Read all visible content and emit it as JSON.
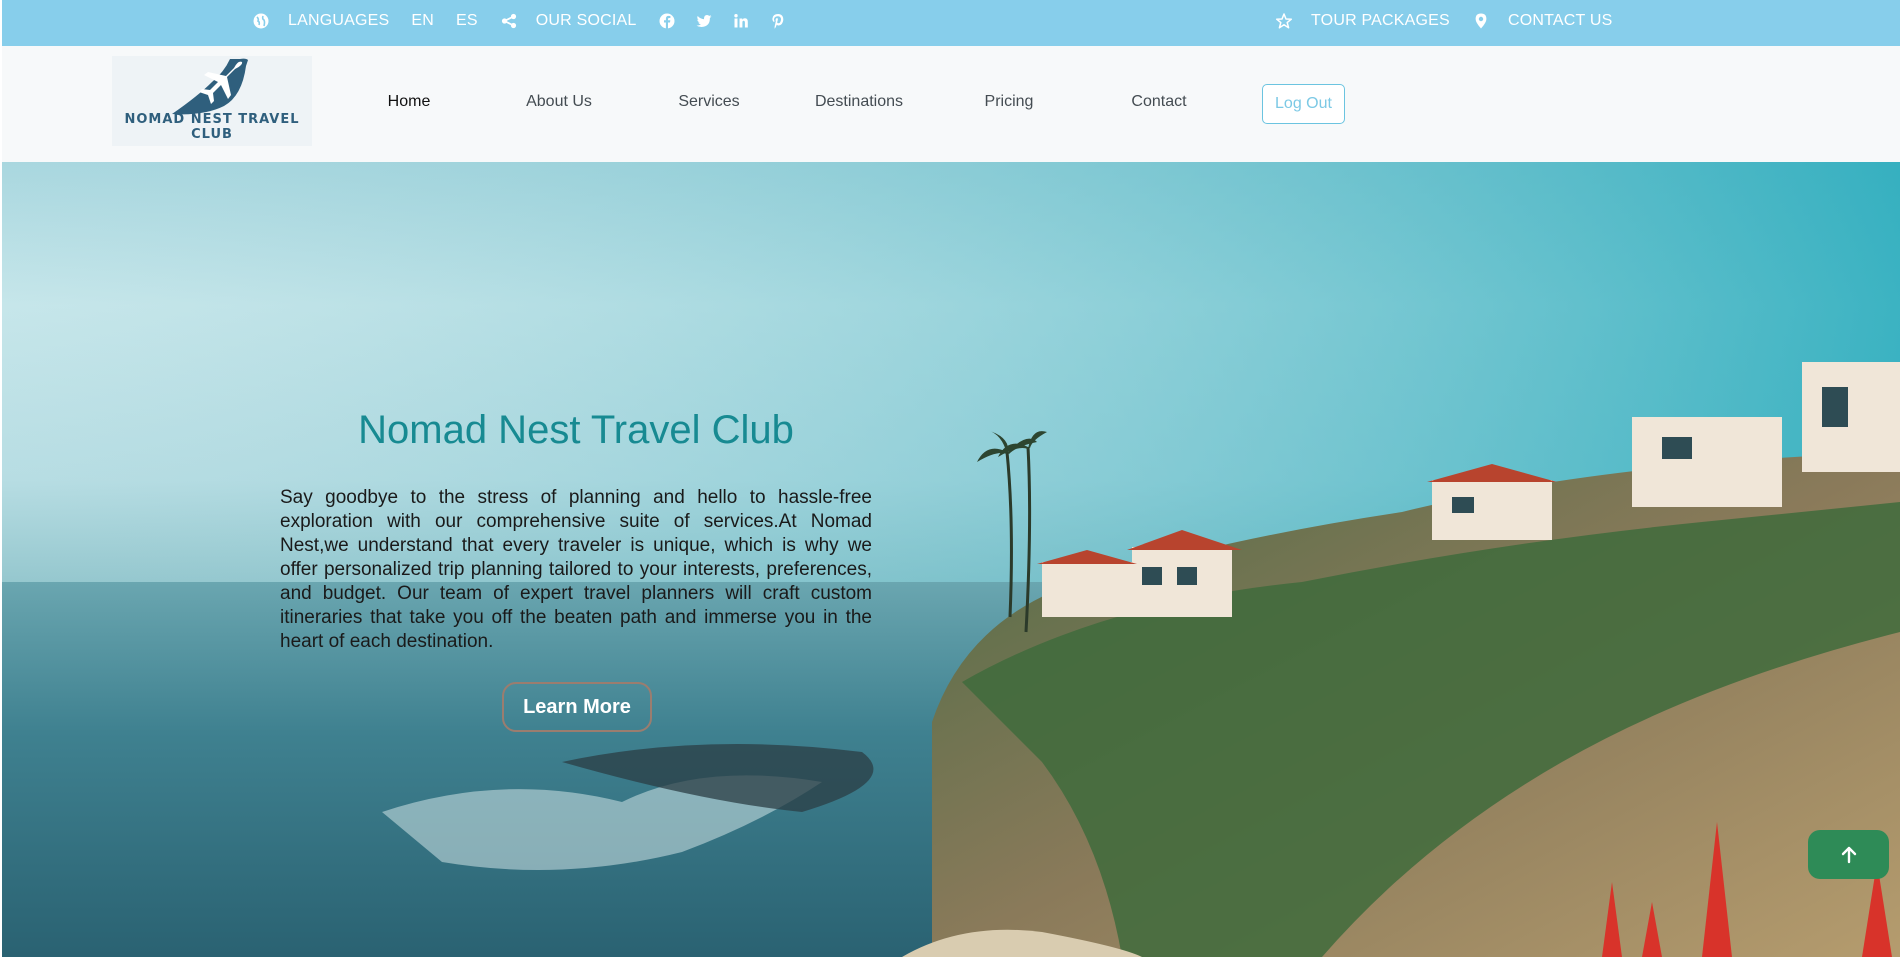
{
  "topbar": {
    "languages_label": "LANGUAGES",
    "lang_en": "EN",
    "lang_es": "ES",
    "social_label": "OUR SOCIAL",
    "social_icons": [
      "facebook-icon",
      "twitter-icon",
      "linkedin-icon",
      "pinterest-icon"
    ],
    "tour_packages": "TOUR PACKAGES",
    "contact_us": "CONTACT US"
  },
  "logo": {
    "text": "NOMAD NEST TRAVEL CLUB"
  },
  "nav": {
    "home": "Home",
    "about": "About Us",
    "services": "Services",
    "destinations": "Destinations",
    "pricing": "Pricing",
    "contact": "Contact",
    "logout": "Log Out"
  },
  "hero": {
    "title": "Nomad Nest Travel Club",
    "body": "Say goodbye to the stress of planning and hello to hassle-free exploration with our comprehensive suite of services.At Nomad Nest,we understand that every traveler is unique, which is why we offer personalized trip planning tailored to your interests, preferences, and budget. Our team of expert travel planners will craft custom itineraries that take you off the beaten path and immerse you in the heart of each destination.",
    "button": "Learn More"
  },
  "colors": {
    "topbar": "#87ceeb",
    "title": "#178a92",
    "logout_border": "#6bc4e0",
    "back_to_top": "#2e8b57"
  }
}
